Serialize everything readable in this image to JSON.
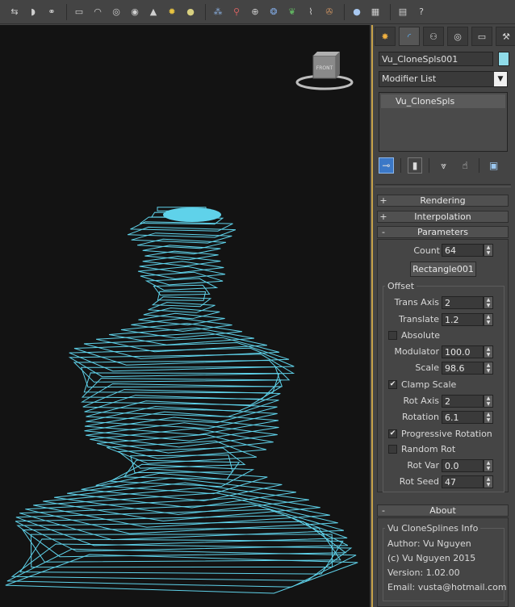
{
  "toolbar": {
    "icons": [
      "transform-icon",
      "snap-icon",
      "links-icon",
      "box-icon",
      "dome-icon",
      "ring-icon",
      "eye-icon",
      "cone-icon",
      "sun-icon",
      "light-icon",
      "particles-icon",
      "connect-icon",
      "sphere-icon",
      "leaf-icon",
      "path-icon",
      "camera-icon",
      "render-icon",
      "calendar-icon",
      "layers-icon",
      "help-icon"
    ]
  },
  "viewport": {
    "viewcube_label": "FRONT",
    "wire_color": "#5fd2ea",
    "background": "#131313"
  },
  "panel": {
    "object_name": "Vu_CloneSpls001",
    "object_color": "#8fdbe8",
    "modifier_list": "Modifier List",
    "stack_items": [
      "Vu_CloneSpls"
    ],
    "rollouts": {
      "rendering": {
        "sign": "+",
        "title": "Rendering"
      },
      "interpolation": {
        "sign": "+",
        "title": "Interpolation"
      },
      "parameters": {
        "sign": "-",
        "title": "Parameters"
      },
      "about": {
        "sign": "-",
        "title": "About"
      }
    },
    "params": {
      "count_label": "Count",
      "count_value": "64",
      "shape_button": "Rectangle001",
      "offset_title": "Offset",
      "trans_axis_label": "Trans Axis",
      "trans_axis_value": "2",
      "translate_label": "Translate",
      "translate_value": "1.2",
      "absolute_label": "Absolute",
      "absolute_checked": false,
      "modulator_label": "Modulator",
      "modulator_value": "100.0",
      "scale_label": "Scale",
      "scale_value": "98.6",
      "clamp_scale_label": "Clamp Scale",
      "clamp_scale_checked": true,
      "rot_axis_label": "Rot Axis",
      "rot_axis_value": "2",
      "rotation_label": "Rotation",
      "rotation_value": "6.1",
      "progressive_rotation_label": "Progressive Rotation",
      "progressive_rotation_checked": true,
      "random_rot_label": "Random Rot",
      "random_rot_checked": false,
      "rot_var_label": "Rot Var",
      "rot_var_value": "0.0",
      "rot_seed_label": "Rot Seed",
      "rot_seed_value": "47"
    },
    "about": {
      "info_title": "Vu CloneSplines Info",
      "author": "Author: Vu Nguyen",
      "copyright": "(c) Vu Nguyen 2015",
      "version": "Version: 1.02.00",
      "email": "Email: vusta@hotmail.com"
    }
  }
}
